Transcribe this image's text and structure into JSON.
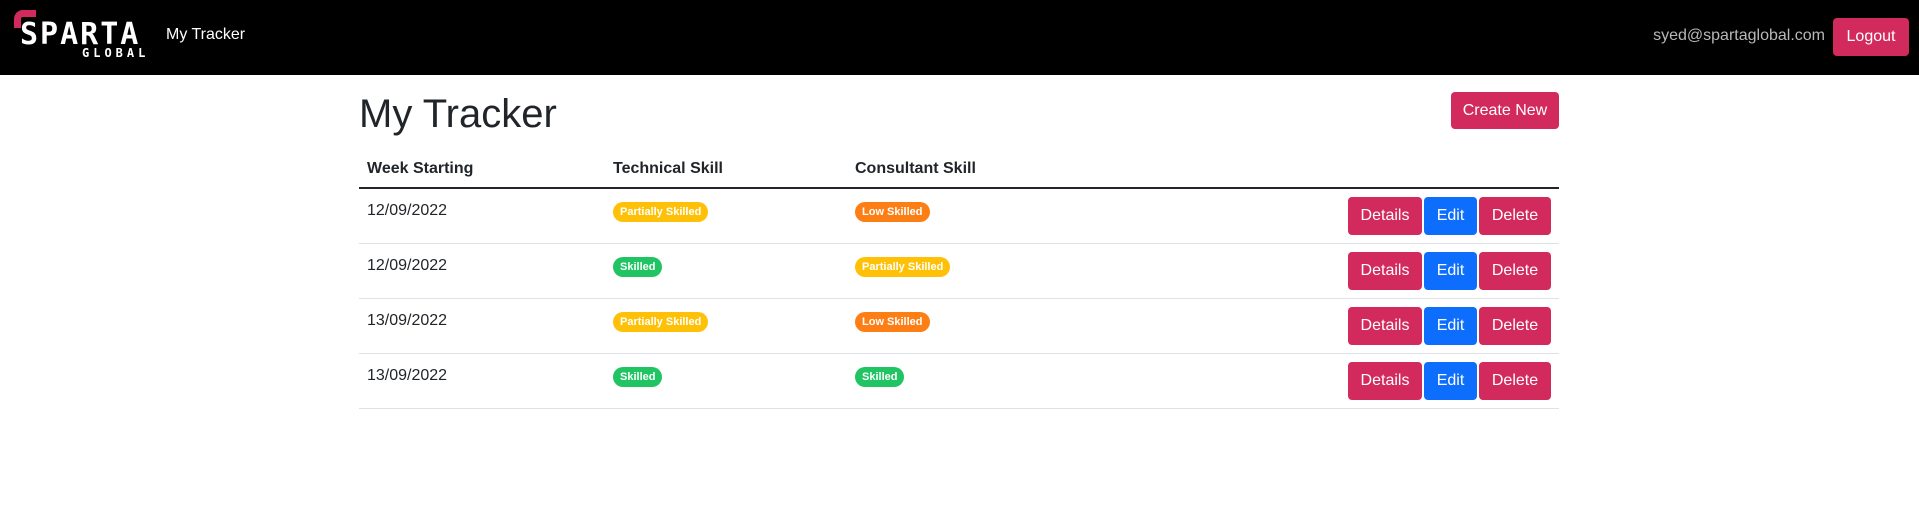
{
  "navbar": {
    "logo_text": "SPARTA",
    "logo_subtext": "GLOBAL",
    "brand_link": "My Tracker",
    "user_email": "syed@spartaglobal.com",
    "logout_label": "Logout"
  },
  "main": {
    "title": "My Tracker",
    "create_label": "Create New",
    "columns": [
      "Week Starting",
      "Technical Skill",
      "Consultant Skill",
      ""
    ],
    "rows": [
      {
        "week": "12/09/2022",
        "technical": "Partially Skilled",
        "consultant": "Low Skilled"
      },
      {
        "week": "12/09/2022",
        "technical": "Skilled",
        "consultant": "Partially Skilled"
      },
      {
        "week": "13/09/2022",
        "technical": "Partially Skilled",
        "consultant": "Low Skilled"
      },
      {
        "week": "13/09/2022",
        "technical": "Skilled",
        "consultant": "Skilled"
      }
    ],
    "row_actions": {
      "details": "Details",
      "edit": "Edit",
      "delete": "Delete"
    }
  },
  "colors": {
    "navbar_bg": "#000000",
    "brand_accent": "#d22a5c",
    "edit_blue": "#0d6efd",
    "partially_skilled": "#ffc107",
    "low_skilled": "#fd7e14",
    "skilled": "#20c463"
  }
}
